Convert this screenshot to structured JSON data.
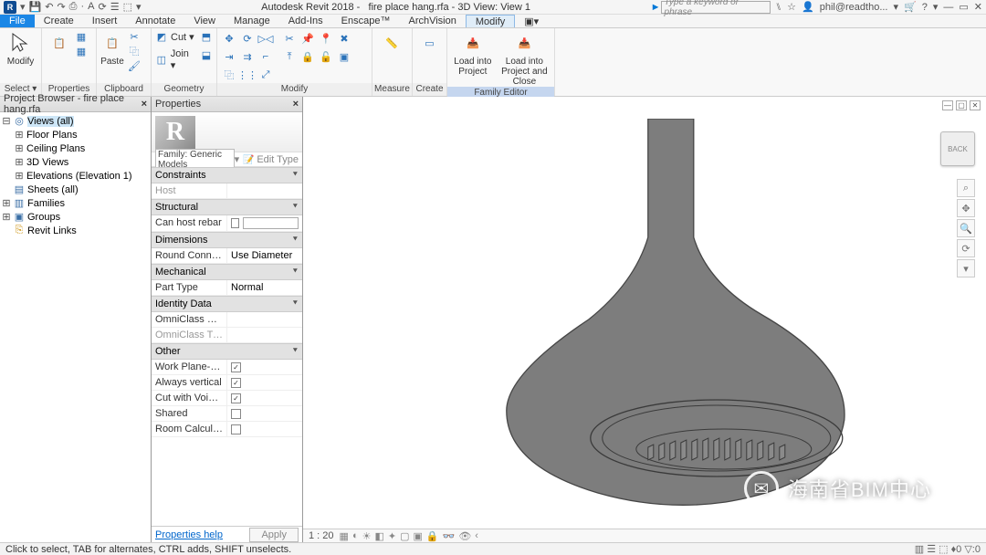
{
  "app": {
    "title": "Autodesk Revit 2018 -",
    "doc": "fire place hang.rfa - 3D View: View 1"
  },
  "search_placeholder": "Type a keyword or phrase",
  "user": "phil@readtho...",
  "tabs": [
    "File",
    "Create",
    "Insert",
    "Annotate",
    "View",
    "Manage",
    "Add-Ins",
    "Enscape™",
    "ArchVision",
    "Modify"
  ],
  "ribbon": {
    "modify_panel": {
      "label": "Modify",
      "sel_label": "Select ▾"
    },
    "properties_panel": {
      "label": "Properties",
      "btn": "Properties"
    },
    "clipboard_panel": {
      "label": "Clipboard",
      "paste": "Paste",
      "cut": "Cut ▾",
      "copy": "Copy",
      "match": "Match"
    },
    "geometry_panel": {
      "label": "Geometry",
      "cut": "Cut ▾",
      "join": "Join ▾"
    },
    "modify2_panel": {
      "label": "Modify"
    },
    "measure_panel": {
      "label": "Measure"
    },
    "create_panel": {
      "label": "Create"
    },
    "fameditor_panel": {
      "label": "Family Editor",
      "load_project": "Load into Project",
      "load_close": "Load into Project and Close"
    }
  },
  "browser": {
    "title": "Project Browser - fire place hang.rfa",
    "views": "Views (all)",
    "floor": "Floor Plans",
    "ceil": "Ceiling Plans",
    "threeD": "3D Views",
    "elev": "Elevations (Elevation 1)",
    "sheets": "Sheets (all)",
    "families": "Families",
    "groups": "Groups",
    "links": "Revit Links"
  },
  "props": {
    "title": "Properties",
    "type": "Family: Generic Models",
    "edit": "Edit Type",
    "cats": {
      "constraints": "Constraints",
      "host": "Host",
      "structural": "Structural",
      "rebar": "Can host rebar",
      "dimensions": "Dimensions",
      "connector": "Round Connector ...",
      "connector_val": "Use Diameter",
      "mechanical": "Mechanical",
      "parttype": "Part Type",
      "parttype_val": "Normal",
      "identity": "Identity Data",
      "omni_num": "OmniClass Number",
      "omni_title": "OmniClass Title",
      "other": "Other",
      "wpb": "Work Plane-Based",
      "av": "Always vertical",
      "cvw": "Cut with Voids Wh...",
      "shared": "Shared",
      "room": "Room Calculation ..."
    },
    "help": "Properties help",
    "apply": "Apply"
  },
  "viewctrl": {
    "scale": "1 : 20"
  },
  "status": {
    "hint": "Click to select, TAB for alternates, CTRL adds, SHIFT unselects.",
    "tray": "▥  ☰  ⬚  ♦0  ▽:0"
  },
  "viewcube": "BACK",
  "watermark": "海南省BIM中心"
}
